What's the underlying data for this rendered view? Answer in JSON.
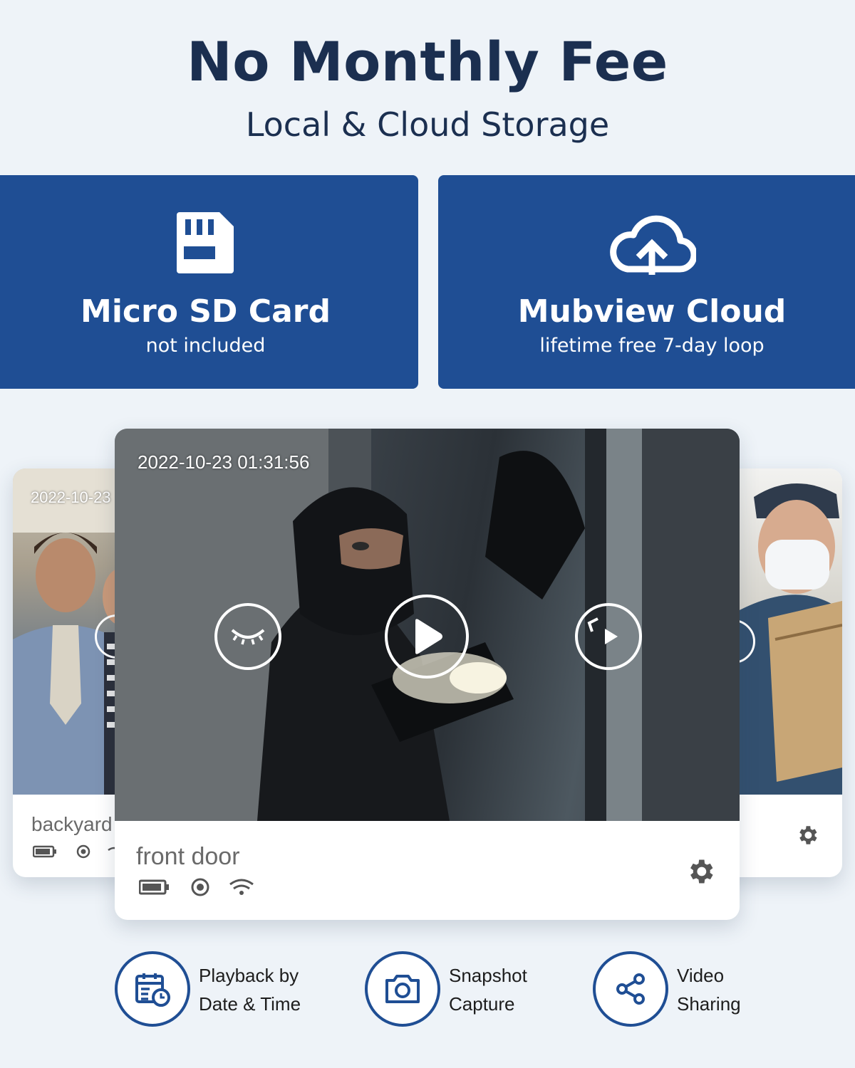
{
  "header": {
    "title": "No Monthly Fee",
    "subtitle": "Local & Cloud Storage"
  },
  "storage": {
    "sd": {
      "title": "Micro SD Card",
      "subtitle": "not included",
      "icon": "sd-card-icon"
    },
    "cloud": {
      "title": "Mubview Cloud",
      "subtitle": "lifetime free 7-day loop",
      "icon": "cloud-upload-icon"
    }
  },
  "cameras": {
    "left": {
      "timestamp": "2022-10-23",
      "name": "backyard"
    },
    "center": {
      "timestamp": "2022-10-23 01:31:56",
      "name": "front door"
    }
  },
  "features": [
    {
      "line1": "Playback by",
      "line2": "Date & Time",
      "icon": "calendar-clock-icon"
    },
    {
      "line1": "Snapshot",
      "line2": "Capture",
      "icon": "camera-icon"
    },
    {
      "line1": "Video",
      "line2": "Sharing",
      "icon": "share-icon"
    }
  ],
  "colors": {
    "brand": "#1f4e94",
    "heading": "#1b2f50",
    "background": "#eef3f8"
  }
}
